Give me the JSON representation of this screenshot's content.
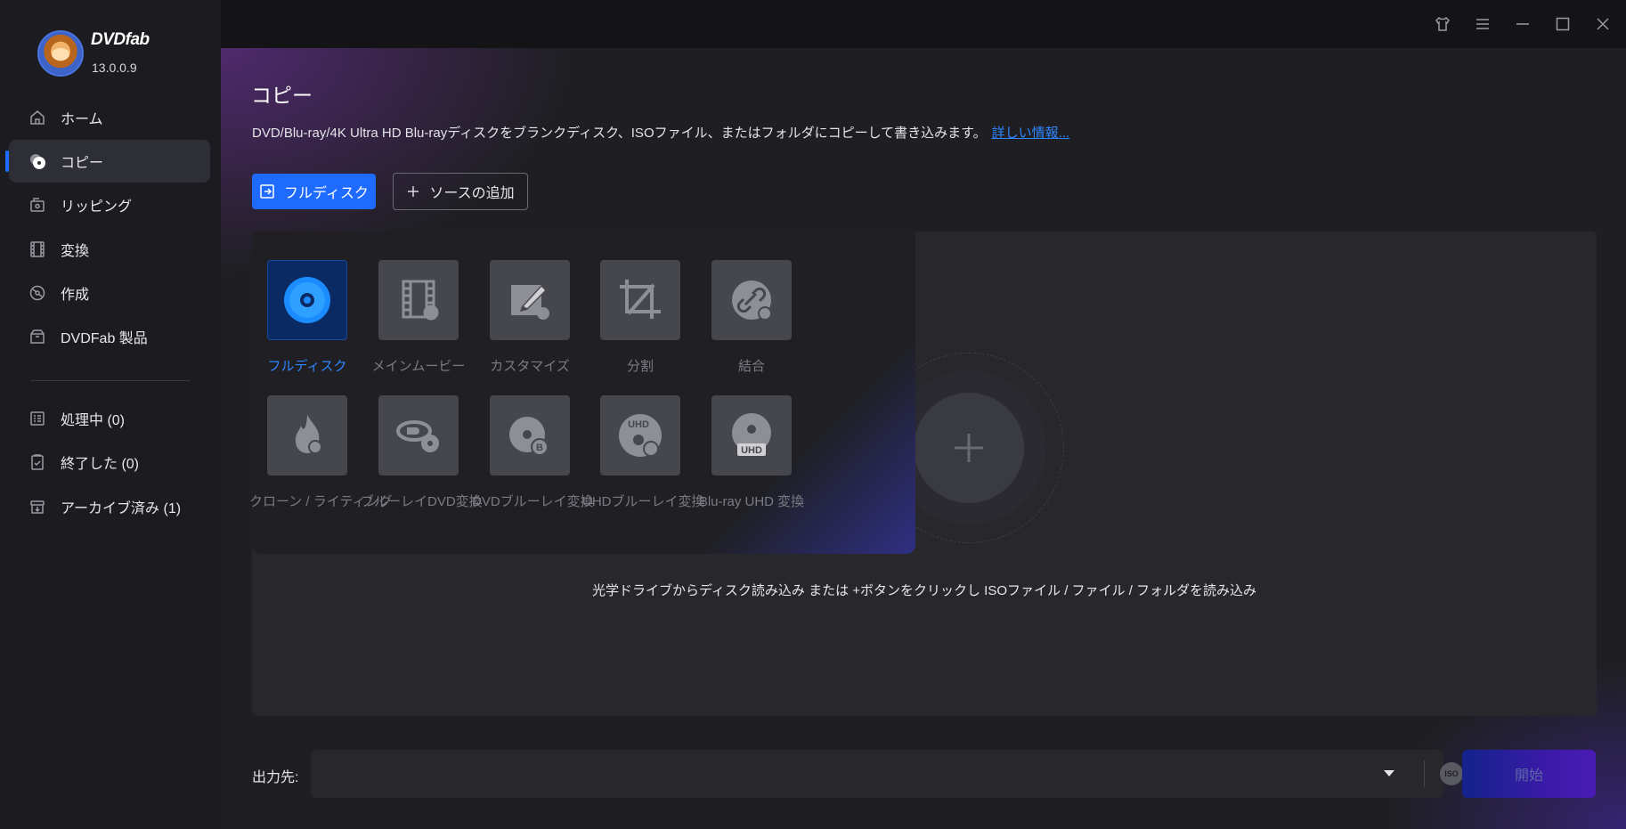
{
  "app": {
    "brand": "DVDfab",
    "version": "13.0.0.9"
  },
  "sidebar": {
    "items": [
      {
        "label": "ホーム",
        "icon": "home-icon"
      },
      {
        "label": "コピー",
        "icon": "disc-copy-icon",
        "active": true
      },
      {
        "label": "リッピング",
        "icon": "ripper-icon"
      },
      {
        "label": "変換",
        "icon": "film-icon"
      },
      {
        "label": "作成",
        "icon": "creator-icon"
      },
      {
        "label": "DVDFab 製品",
        "icon": "box-icon"
      }
    ],
    "tasks": [
      {
        "label": "処理中 (0)",
        "icon": "processing-icon"
      },
      {
        "label": "終了した (0)",
        "icon": "finished-icon"
      },
      {
        "label": "アーカイブ済み (1)",
        "icon": "archive-icon"
      }
    ]
  },
  "main": {
    "title": "コピー",
    "description": "DVD/Blu-ray/4K Ultra HD Blu-rayディスクをブランクディスク、ISOファイル、またはフォルダにコピーして書き込みます。",
    "more_link": "詳しい情報...",
    "mode_button": "フルディスク",
    "add_source_button": "ソースの追加",
    "drop_hint": "光学ドライブからディスク読み込み または +ボタンをクリックし ISOファイル / ファイル / フォルダを読み込み"
  },
  "modes": [
    {
      "label": "フルディスク",
      "icon": "full-disc-icon",
      "active": true
    },
    {
      "label": "メインムービー",
      "icon": "main-movie-icon"
    },
    {
      "label": "カスタマイズ",
      "icon": "customize-icon"
    },
    {
      "label": "分割",
      "icon": "split-icon"
    },
    {
      "label": "結合",
      "icon": "merge-icon"
    },
    {
      "label": "クローン / ライティング",
      "icon": "clone-burn-icon"
    },
    {
      "label": "ブルーレイDVD変換",
      "icon": "bluray-to-dvd-icon"
    },
    {
      "label": "DVDブルーレイ変換",
      "icon": "dvd-to-bluray-icon"
    },
    {
      "label": "UHDブルーレイ変換",
      "icon": "uhd-to-bluray-icon"
    },
    {
      "label": "Blu-ray UHD 変換",
      "icon": "bluray-to-uhd-icon"
    }
  ],
  "output": {
    "label": "出力先:",
    "value": "",
    "iso_label": "ISO",
    "start_button": "開始"
  },
  "colors": {
    "accent": "#1f6bff",
    "link": "#2f86ff",
    "background": "#1f1f23"
  }
}
